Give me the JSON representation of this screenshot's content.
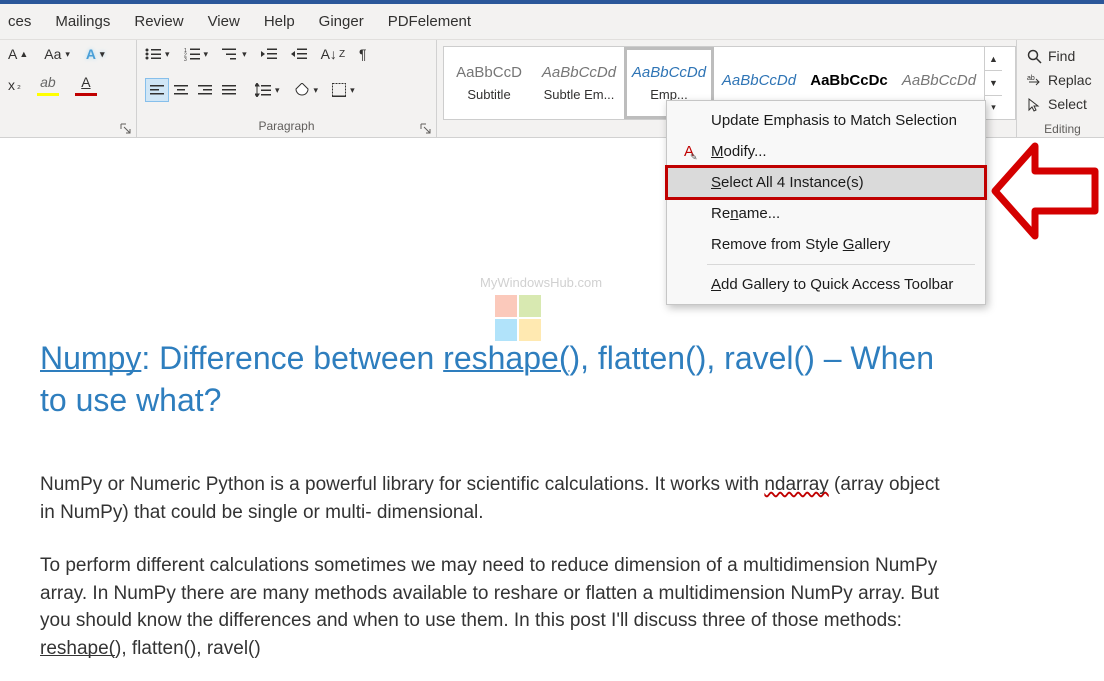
{
  "tabs": {
    "t1": "ces",
    "t2": "Mailings",
    "t3": "Review",
    "t4": "View",
    "t5": "Help",
    "t6": "Ginger",
    "t7": "PDFelement"
  },
  "ribbon": {
    "paragraph_label": "Paragraph"
  },
  "styles": {
    "s1_sample": "AaBbCcD",
    "s1_name": "Subtitle",
    "s2_sample": "AaBbCcDd",
    "s2_name": "Subtle Em...",
    "s3_sample": "AaBbCcDd",
    "s3_name": "Emp...",
    "s4_sample": "AaBbCcDd",
    "s4_name": "",
    "s5_sample": "AaBbCcDc",
    "s5_name": "",
    "s6_sample": "AaBbCcDd",
    "s6_name": ""
  },
  "editing": {
    "find": "Find",
    "replace": "Replac",
    "select": "Select",
    "label": "Editing"
  },
  "context_menu": {
    "item1": "Update Emphasis to Match Selection",
    "item2_pre": "M",
    "item2_post": "odify...",
    "item3_pre": "S",
    "item3_post": "elect All 4 Instance(s)",
    "item4_pre": "Re",
    "item4_mnem": "n",
    "item4_post": "ame...",
    "item5_pre": "Remove from Style ",
    "item5_mnem": "G",
    "item5_post": "allery",
    "item6_pre": "A",
    "item6_post": "dd Gallery to Quick Access Toolbar"
  },
  "document": {
    "heading_p1": "Numpy",
    "heading_p2": ": Difference between ",
    "heading_p3": "reshape(",
    "heading_p4": "), flatten(), ravel() – When to use what?",
    "para1_a": "NumPy or Numeric Python is a powerful library for scientific calculations. It works with ",
    "para1_b": "ndarray",
    "para1_c": " (array object in NumPy) that could be single or multi- dimensional.",
    "para2_a": "To perform different calculations sometimes we may need to reduce dimension of a multidimension NumPy array. In NumPy there are many methods available to reshare or flatten a multidimension NumPy array. But you should know the differences and when to use them. In this post I'll discuss three of those methods: ",
    "para2_b": "reshape(",
    "para2_c": "), flatten(), ravel()"
  },
  "watermark": "MyWindowsHub.com"
}
